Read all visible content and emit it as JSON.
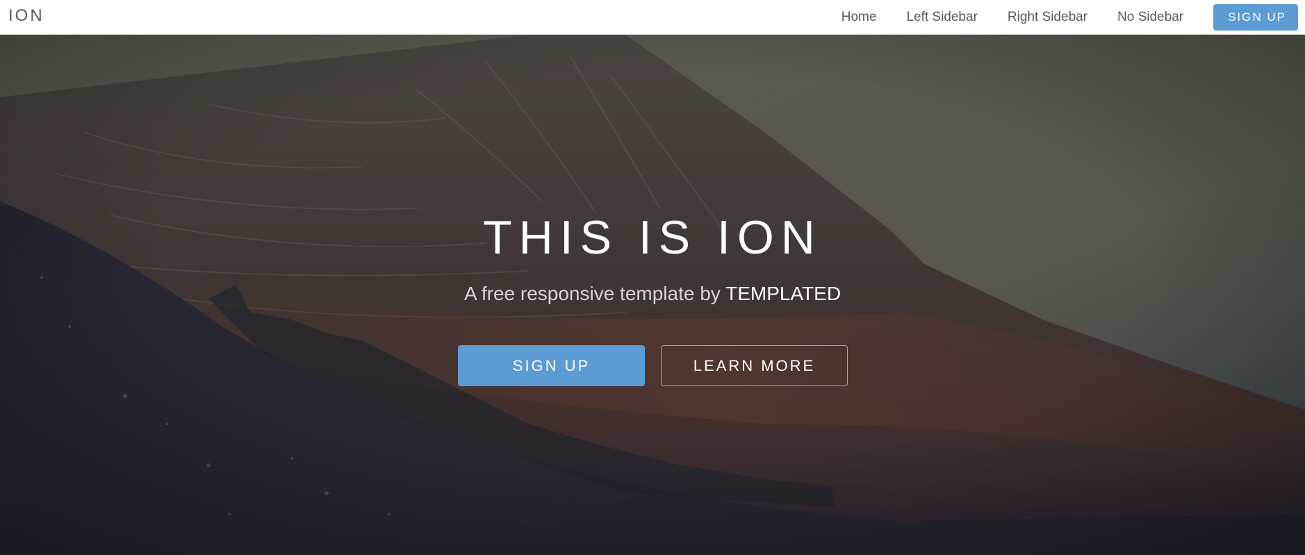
{
  "header": {
    "logo": "ION",
    "nav": [
      {
        "label": "Home"
      },
      {
        "label": "Left Sidebar"
      },
      {
        "label": "Right Sidebar"
      },
      {
        "label": "No Sidebar"
      }
    ],
    "signup_label": "SIGN UP"
  },
  "banner": {
    "title": "THIS IS ION",
    "subtitle_prefix": "A free responsive template by",
    "subtitle_brand": "TEMPLATED",
    "primary_button": "SIGN UP",
    "secondary_button": "LEARN MORE"
  },
  "colors": {
    "accent": "#5d9bd4",
    "nav_text": "#555a60",
    "header_bg": "#ffffff"
  }
}
